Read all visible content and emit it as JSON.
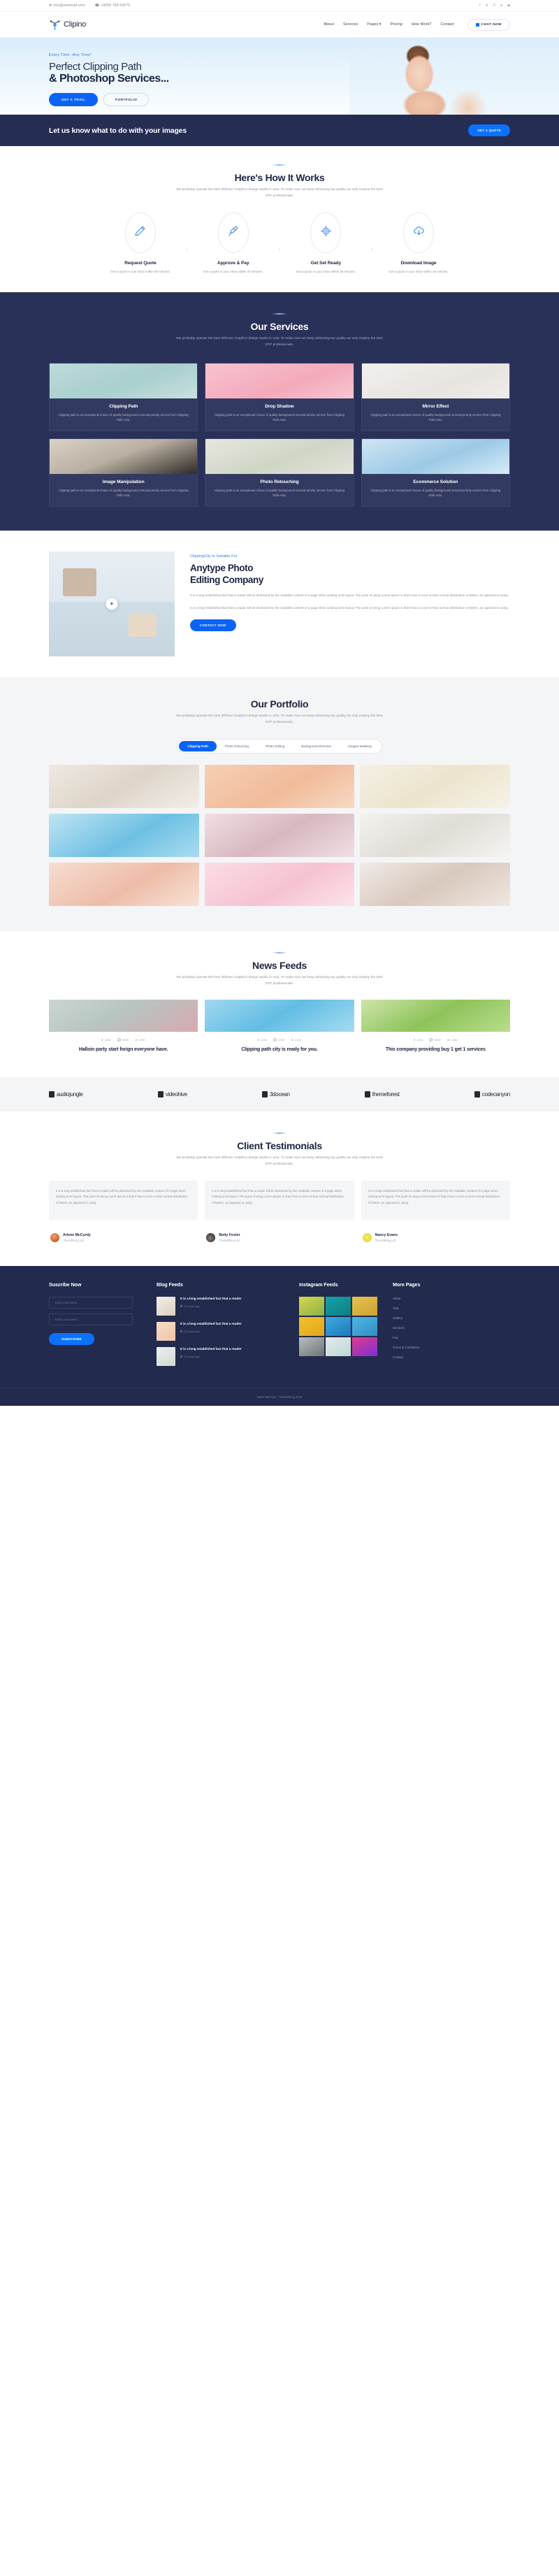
{
  "topbar": {
    "email": "info@webmail.com",
    "phone": "+9908 768 64576",
    "email_icon": "envelope-icon",
    "phone_icon": "phone-icon",
    "social": [
      "facebook-icon",
      "twitter-icon",
      "pinterest-icon",
      "dribbble-icon",
      "behance-icon"
    ],
    "social_glyphs": [
      "f",
      "❈",
      "ℙ",
      "●",
      "◆"
    ]
  },
  "header": {
    "brand": "Clipino",
    "nav": [
      {
        "label": "About"
      },
      {
        "label": "Servcies"
      },
      {
        "label": "Pages ▾"
      },
      {
        "label": "Pricing"
      },
      {
        "label": "How Work?"
      },
      {
        "label": "Contact"
      }
    ],
    "chat_label": "CHAT NOW"
  },
  "hero": {
    "kicker": "Every Time -Any Time!",
    "line1": "Perfect Clipping Path",
    "line2": "& Photoshop Services...",
    "btn_primary": "GET A TRAIL",
    "btn_secondary": "PORTFOLIO"
  },
  "cta": {
    "title": "Let us know what to do with your images",
    "button": "GET A QUOTE"
  },
  "how": {
    "title": "Here's How It Works",
    "subtitle": "We probably operate the best offshore Graphics design studio in Asia. To make sure we keep delivering top quality we only employ the best DTP professionals.",
    "steps": [
      {
        "icon": "pencil-icon",
        "name": "Request Quote",
        "desc": "Get a quote in your inbox within 45 minutes."
      },
      {
        "icon": "pen-nib-icon",
        "name": "Approve & Pay",
        "desc": "Get a quote in your inbox within 45 minutes."
      },
      {
        "icon": "target-icon",
        "name": "Get Set Ready",
        "desc": "Get a quote in your inbox within 45 minutes."
      },
      {
        "icon": "cloud-download-icon",
        "name": "Download Image",
        "desc": "Get a quote in your inbox within 45 minutes."
      }
    ],
    "arrow": "›"
  },
  "services": {
    "title": "Our Services",
    "subtitle": "We probably operate the best offshore Graphics design studio in Asia. To make sure we keep delivering top quality we only employ the best DTP professionals.",
    "desc_common": "Clipping path is an exceptional choice of quality background removal priority service from Clipping Path Asia.",
    "items": [
      {
        "name": "Clipping Path",
        "img": "cosmetic-bottles-teal"
      },
      {
        "name": "Drop Shadow",
        "img": "pink-background-product"
      },
      {
        "name": "Mirror Effect",
        "img": "sunglasses-flatlay"
      },
      {
        "name": "Image Manipulation",
        "img": "dark-dropper-bottle"
      },
      {
        "name": "Photo Retouching",
        "img": "plant-cosmetics"
      },
      {
        "name": "Ecommerce Solution",
        "img": "blue-cosmetic-box"
      }
    ]
  },
  "about": {
    "kicker": "ClippingCity Is Suitable For",
    "heading_l1": "Anytype Photo",
    "heading_l2": "Editing Company",
    "p1": "It is a long established fact that a reader will be distracted by the readable content of a page when looking at its layout. The point of using Lorem Ipsum is that it has a more-or-less normal distribution of letters, as opposed to using.",
    "p2": "It is a long established fact that a reader will be distracted by the readable content of a page when looking at its layout. The point of using Lorem Ipsum is that it has a more-or-less normal distribution of letters, as opposed to using.",
    "button": "CONTACT NOW",
    "play_icon": "play-icon"
  },
  "portfolio": {
    "title": "Our Portfolio",
    "subtitle": "We probably operate the best offshore Graphics design studio in Asia. To make sure we keep delivering top quality we only employ the best DTP professionals.",
    "tabs": [
      {
        "label": "Clipping Path",
        "active": true
      },
      {
        "label": "Photo Retuching",
        "active": false
      },
      {
        "label": "Photo Editing",
        "active": false
      },
      {
        "label": "Background Remove",
        "active": false
      },
      {
        "label": "Images Masking",
        "active": false
      }
    ],
    "items": [
      {
        "name": "desk-flatlay-keyboard"
      },
      {
        "name": "peach-notebook-pencils"
      },
      {
        "name": "banana-yellow-flatlay"
      },
      {
        "name": "blue-water-cosmetic-tube"
      },
      {
        "name": "makeup-brushes-pink"
      },
      {
        "name": "bakery-marble-board"
      },
      {
        "name": "red-lips-model"
      },
      {
        "name": "pink-roses-petals"
      },
      {
        "name": "two-women-red-gift"
      }
    ]
  },
  "news": {
    "title": "News Feeds",
    "subtitle": "We probably operate the best offshore Graphics design studio in Asia. To make sure we keep delivering top quality we only employ the best DTP professionals.",
    "stats": {
      "likes": "123K",
      "comments": "343K",
      "shares": "129K"
    },
    "icons": {
      "like": "heart-icon",
      "comment": "comment-icon",
      "share": "share-icon"
    },
    "items": [
      {
        "title": "Halloin party start forign everyone have.",
        "img": "woman-pink-gift"
      },
      {
        "title": "Clipping path city is ready for you.",
        "img": "blue-bottles-pair"
      },
      {
        "title": "This company providing buy 1 get 1 services",
        "img": "green-cosmetic-bottle"
      }
    ]
  },
  "brands": [
    {
      "name": "audiojungle",
      "icon": "audiojungle-icon"
    },
    {
      "name": "videohive",
      "icon": "videohive-icon"
    },
    {
      "name": "3docean",
      "icon": "3docean-icon"
    },
    {
      "name": "themeforest",
      "icon": "themeforest-icon"
    },
    {
      "name": "codecanyon",
      "icon": "codecanyon-icon"
    }
  ],
  "testimonials": {
    "title": "Client Testimonials",
    "subtitle": "We probably operate the best offshore Graphics design studio in Asia. To make sure we keep delivering top quality we only employ the best DTP professionals.",
    "quote_common": "It is a long established fact that a reader will be distracted by the readable content of a page when looking at its layout. The point of using Lorem Ipsum is that it has a more-or-less normal distribution of letters, as opposed to using.",
    "items": [
      {
        "name": "Arlene McCurdy",
        "role": "TheSoftKing Ltd.",
        "avatar_color": "#c6622d"
      },
      {
        "name": "Betty Foster",
        "role": "TheSoftKing Ltd.",
        "avatar_color": "#3b3b3b"
      },
      {
        "name": "Nancy Evans",
        "role": "TheSoftKing Ltd.",
        "avatar_color": "#e4dc2a"
      }
    ]
  },
  "footer": {
    "subscribe": {
      "title": "Suscribe Now",
      "placeholder1": "Enter your name...",
      "placeholder2": "Enter your name...",
      "button": "SUBSCRIBE"
    },
    "blog": {
      "title": "Blog Feeds",
      "items": [
        {
          "title": "It is a long established fact that a reader",
          "time": "23 hours ago",
          "img": "food-flatlay"
        },
        {
          "title": "It is a long established fact that a reader",
          "time": "23 hours ago",
          "img": "peach-paper-flatlay"
        },
        {
          "title": "It is a long established fact that a reader",
          "time": "23 hours ago",
          "img": "white-bottles"
        }
      ],
      "clock_icon": "clock-icon"
    },
    "instagram": {
      "title": "Instagram Feeds",
      "tiles": [
        "yellow-green-portrait",
        "teal-dress-woman",
        "sunglasses-yellow-jacket",
        "yellow-bg-sitting",
        "blue-jacket-man",
        "red-sweater-man",
        "bw-collage",
        "teal-eggs",
        "neon-portrait"
      ]
    },
    "pages": {
      "title": "More Pages",
      "links": [
        "About",
        "Trial",
        "Gallery",
        "Services",
        "Faq",
        "Terms & Conditions",
        "Contact"
      ]
    },
    "copyright": "Made with love - TheSoftKing 2018"
  },
  "colors": {
    "accent": "#0b63f6",
    "dark": "#262d52",
    "services_bg": "#2a3158",
    "footer_bg": "#222a4d",
    "muted": "#8b90a0"
  }
}
